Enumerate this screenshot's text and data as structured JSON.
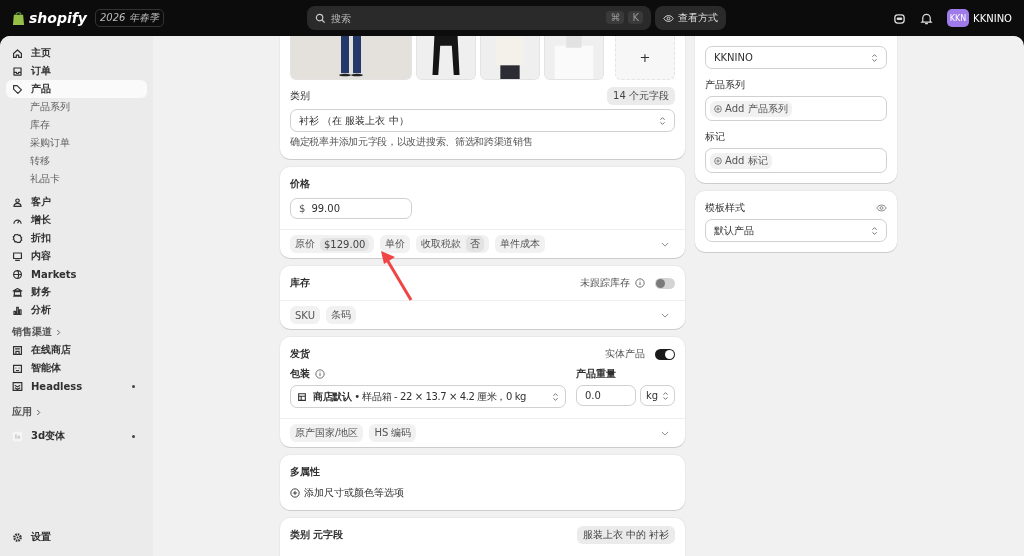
{
  "topbar": {
    "logo_text": "shopify",
    "edition": "2026 年春季",
    "search": {
      "placeholder": "搜索"
    },
    "shortcut_keys": [
      "⌘",
      "K"
    ],
    "view_button": "查看方式",
    "avatar_initials": "KKN",
    "store_name": "KKNINO"
  },
  "sidebar": {
    "items": [
      {
        "label": "主页",
        "selected": false
      },
      {
        "label": "订单",
        "selected": false
      },
      {
        "label": "产品",
        "selected": true,
        "children": [
          {
            "label": "产品系列",
            "selected": false
          },
          {
            "label": "库存",
            "selected": false
          },
          {
            "label": "采购订单",
            "selected": false
          },
          {
            "label": "转移",
            "selected": false
          },
          {
            "label": "礼品卡",
            "selected": false
          }
        ]
      },
      {
        "label": "客户",
        "selected": false
      },
      {
        "label": "增长",
        "selected": false
      },
      {
        "label": "折扣",
        "selected": false
      },
      {
        "label": "内容",
        "selected": false
      },
      {
        "label": "Markets",
        "selected": false
      },
      {
        "label": "财务",
        "selected": false
      },
      {
        "label": "分析",
        "selected": false
      }
    ],
    "channels": {
      "heading": "销售渠道",
      "items": [
        {
          "label": "在线商店",
          "selected": false,
          "dot": false
        },
        {
          "label": "智能体",
          "selected": false,
          "dot": false
        },
        {
          "label": "Headless",
          "selected": false,
          "dot": true
        }
      ]
    },
    "apps": {
      "heading": "应用",
      "items": [
        {
          "label": "3d变体",
          "selected": false,
          "dot": true
        }
      ]
    },
    "settings": "设置"
  },
  "media": {
    "add_button": "+",
    "category_label": "类别",
    "metafield_badge": "14 个元字段",
    "category_value": "衬衫 （在 服装上衣 中）",
    "help_text": "确定税率并添加元字段，以改进搜索、筛选和跨渠道销售"
  },
  "price": {
    "title": "价格",
    "currency": "$",
    "value": "99.00",
    "chips": [
      {
        "label": "原价",
        "value": "$129.00"
      },
      {
        "label": "单价"
      },
      {
        "label": "收取税款",
        "value": "否"
      },
      {
        "label": "单件成本"
      }
    ]
  },
  "inventory": {
    "title": "库存",
    "toggle_label": "未跟踪库存",
    "on": false,
    "chips": [
      {
        "label": "SKU"
      },
      {
        "label": "条码"
      }
    ]
  },
  "shipping": {
    "title": "发货",
    "toggle_label": "实体产品",
    "on": true,
    "package_label": "包装",
    "package_value": "**商店默认** • 样品箱 - 22 × 13.7 × 4.2 厘米，0 kg",
    "weight_label": "产品重量",
    "weight_value": "0.0",
    "weight_unit": "kg",
    "chips": [
      {
        "label": "原产国家/地区"
      },
      {
        "label": "HS 编码"
      }
    ]
  },
  "variants": {
    "title": "多属性",
    "add_link": "添加尺寸或颜色等选项"
  },
  "category_metafields": {
    "title": "类别 元字段",
    "badge": "服装上衣 中的 衬衫"
  },
  "organization": {
    "vendor_value": "KKNINO",
    "collections_label": "产品系列",
    "collections_add": "Add 产品系列",
    "tags_label": "标记",
    "tags_add": "Add 标记"
  },
  "template": {
    "title": "模板样式",
    "value": "默认产品"
  }
}
